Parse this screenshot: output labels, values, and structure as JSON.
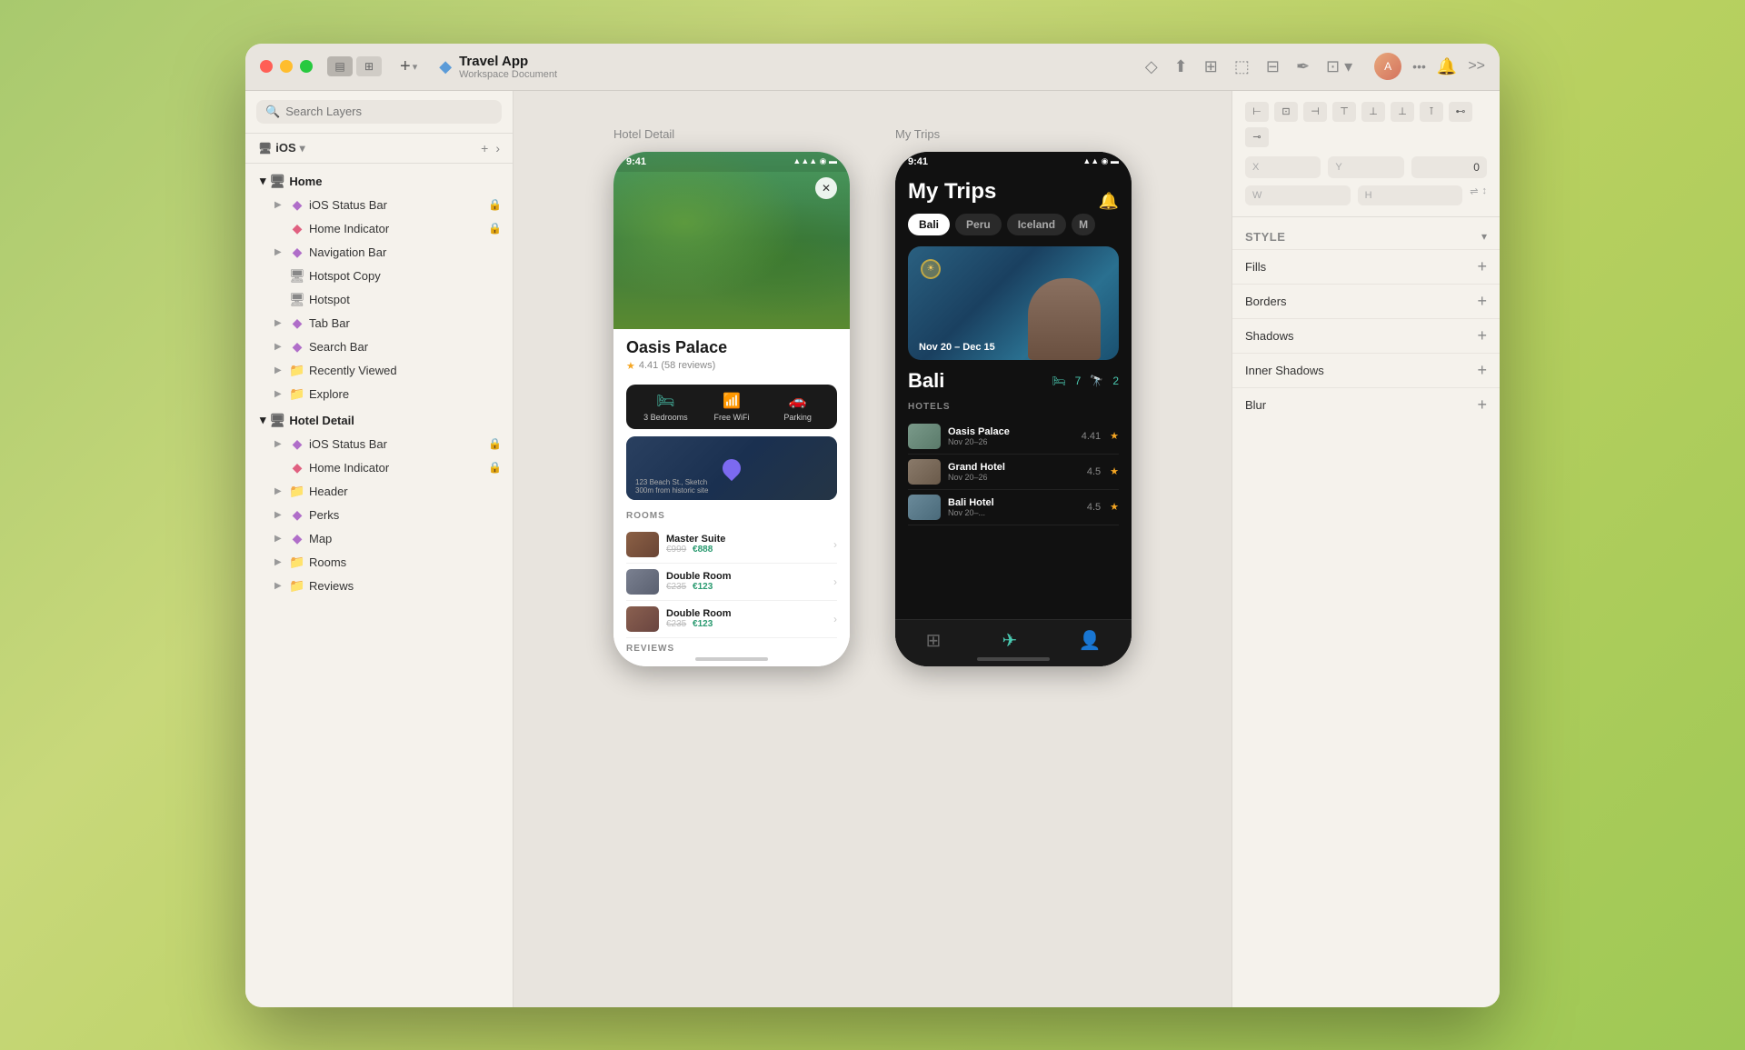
{
  "window": {
    "title": "Travel App",
    "subtitle": "Workspace Document"
  },
  "titlebar": {
    "add_label": "+",
    "more_label": "..."
  },
  "toolbar": {
    "icons": [
      "◇",
      "⬆",
      "⊞",
      "⊡",
      "⊟",
      "✂",
      "⬚",
      "▶"
    ]
  },
  "search": {
    "placeholder": "Search Layers"
  },
  "ios_selector": {
    "label": "iOS",
    "add": "+",
    "nav": "›"
  },
  "layers": {
    "home_group": {
      "label": "Home",
      "children": [
        {
          "name": "iOS Status Bar",
          "indent": 1,
          "icon": "diamond",
          "lock": true,
          "has_chevron": true
        },
        {
          "name": "Home Indicator",
          "indent": 1,
          "icon": "diamond_pink",
          "lock": true
        },
        {
          "name": "Navigation Bar",
          "indent": 1,
          "icon": "diamond",
          "has_chevron": true
        },
        {
          "name": "Hotspot Copy",
          "indent": 1,
          "icon": "screen"
        },
        {
          "name": "Hotspot",
          "indent": 1,
          "icon": "screen"
        },
        {
          "name": "Tab Bar",
          "indent": 1,
          "icon": "diamond",
          "has_chevron": true
        },
        {
          "name": "Search Bar",
          "indent": 1,
          "icon": "diamond",
          "has_chevron": true
        },
        {
          "name": "Recently Viewed",
          "indent": 1,
          "icon": "folder",
          "has_chevron": true
        },
        {
          "name": "Explore",
          "indent": 1,
          "icon": "folder",
          "has_chevron": true
        }
      ]
    },
    "hotel_group": {
      "label": "Hotel Detail",
      "children": [
        {
          "name": "iOS Status Bar",
          "indent": 1,
          "icon": "diamond",
          "lock": true,
          "has_chevron": true
        },
        {
          "name": "Home Indicator",
          "indent": 1,
          "icon": "diamond_pink",
          "lock": true
        },
        {
          "name": "Header",
          "indent": 1,
          "icon": "folder",
          "has_chevron": true
        },
        {
          "name": "Perks",
          "indent": 1,
          "icon": "diamond",
          "has_chevron": true
        },
        {
          "name": "Map",
          "indent": 1,
          "icon": "diamond",
          "has_chevron": true
        },
        {
          "name": "Rooms",
          "indent": 1,
          "icon": "folder",
          "has_chevron": true
        },
        {
          "name": "Reviews",
          "indent": 1,
          "icon": "folder",
          "has_chevron": true
        }
      ]
    }
  },
  "hotel_detail": {
    "label": "Hotel Detail",
    "status_time": "9:41",
    "hotel_name": "Oasis Palace",
    "rating": "4.41 (58 reviews)",
    "amenities": [
      {
        "icon": "🛏",
        "text": "3 Bedrooms"
      },
      {
        "icon": "📶",
        "text": "Free WiFi"
      },
      {
        "icon": "🚗",
        "text": "Parking"
      }
    ],
    "address": "123 Beach St., Sketch",
    "address2": "300m from historic site",
    "rooms_title": "ROOMS",
    "rooms": [
      {
        "name": "Master Suite",
        "price_old": "€999",
        "price_new": "€888"
      },
      {
        "name": "Double Room",
        "price_old": "€235",
        "price_new": "€123"
      },
      {
        "name": "Double Room",
        "price_old": "€235",
        "price_new": "€123"
      }
    ],
    "reviews_title": "REVIEWS"
  },
  "my_trips": {
    "label": "My Trips",
    "status_time": "9:41",
    "title": "My Trips",
    "tabs": [
      "Bali",
      "Peru",
      "Iceland",
      "M"
    ],
    "active_tab": "Bali",
    "dates": "Nov 20 – Dec 15",
    "destination": "Bali",
    "stat1": "7",
    "stat2": "2",
    "hotels_title": "HOTELS",
    "hotels": [
      {
        "name": "Oasis Palace",
        "dates": "Nov 20–26",
        "rating": "4.41"
      },
      {
        "name": "Grand Hotel",
        "dates": "Nov 20–26",
        "rating": "4.5"
      },
      {
        "name": "Bali Hotel",
        "dates": "Nov 20–...",
        "rating": "4.5"
      }
    ]
  },
  "right_panel": {
    "style_label": "STYLE",
    "sections": [
      {
        "name": "Fills",
        "label": "Fills"
      },
      {
        "name": "Borders",
        "label": "Borders"
      },
      {
        "name": "Shadows",
        "label": "Shadows"
      },
      {
        "name": "Inner Shadows",
        "label": "Inner Shadows"
      },
      {
        "name": "Blur",
        "label": "Blur"
      }
    ]
  }
}
